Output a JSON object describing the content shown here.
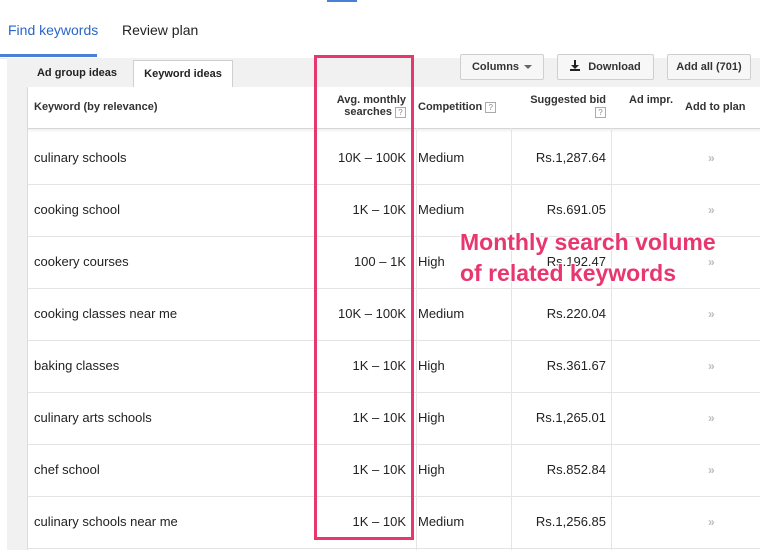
{
  "nav": {
    "tabs": [
      {
        "label": "Find keywords"
      },
      {
        "label": "Review plan"
      }
    ]
  },
  "subtabs": [
    {
      "label": "Ad group ideas"
    },
    {
      "label": "Keyword ideas"
    }
  ],
  "toolbar": {
    "columns_label": "Columns",
    "download_label": "Download",
    "add_all_label": "Add all (701)"
  },
  "table": {
    "headers": {
      "keyword": "Keyword (by relevance)",
      "avg_line1": "Avg. monthly",
      "avg_line2": "searches",
      "competition": "Competition",
      "bid_line1": "Suggested bid",
      "ad_impr": "Ad impr.",
      "add_to_plan": "Add to plan",
      "help": "?"
    },
    "rows": [
      {
        "keyword": "culinary schools",
        "avg": "10K – 100K",
        "competition": "Medium",
        "bid": "Rs.1,287.64",
        "arrow": "»"
      },
      {
        "keyword": "cooking school",
        "avg": "1K – 10K",
        "competition": "Medium",
        "bid": "Rs.691.05",
        "arrow": "»"
      },
      {
        "keyword": "cookery courses",
        "avg": "100 – 1K",
        "competition": "High",
        "bid": "Rs.192.47",
        "arrow": "»"
      },
      {
        "keyword": "cooking classes near me",
        "avg": "10K – 100K",
        "competition": "Medium",
        "bid": "Rs.220.04",
        "arrow": "»"
      },
      {
        "keyword": "baking classes",
        "avg": "1K – 10K",
        "competition": "High",
        "bid": "Rs.361.67",
        "arrow": "»"
      },
      {
        "keyword": "culinary arts schools",
        "avg": "1K – 10K",
        "competition": "High",
        "bid": "Rs.1,265.01",
        "arrow": "»"
      },
      {
        "keyword": "chef school",
        "avg": "1K – 10K",
        "competition": "High",
        "bid": "Rs.852.84",
        "arrow": "»"
      },
      {
        "keyword": "culinary schools near me",
        "avg": "1K – 10K",
        "competition": "Medium",
        "bid": "Rs.1,256.85",
        "arrow": "»"
      }
    ]
  },
  "annotation": {
    "line1": "Monthly search volume",
    "line2": "of related keywords",
    "color": "#e8366f"
  },
  "colors": {
    "accent": "#4a7fd6",
    "highlight": "#e8366f"
  }
}
